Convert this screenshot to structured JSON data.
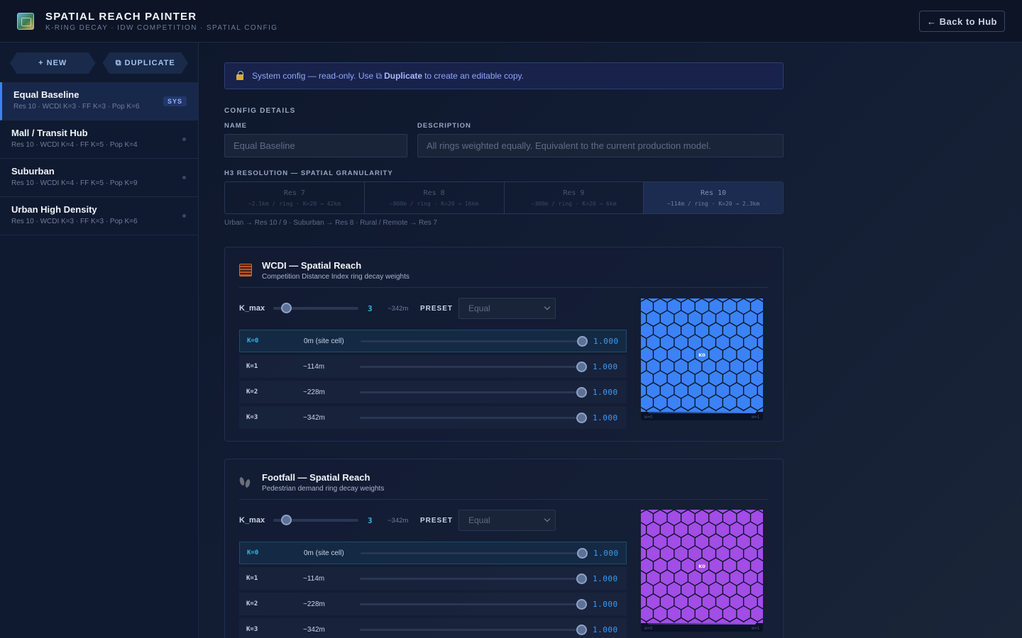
{
  "header": {
    "title": "SPATIAL REACH PAINTER",
    "subtitle": "K-RING DECAY · IDW COMPETITION · SPATIAL CONFIG",
    "back_label": "← Back to Hub",
    "logo_icon": "map-icon"
  },
  "sidebar": {
    "new_label": "+ NEW",
    "duplicate_label": "⧉ DUPLICATE",
    "items": [
      {
        "name": "Equal Baseline",
        "meta": "Res 10 · WCDI K=3 · FF K=3 · Pop K=6",
        "badge": "SYS",
        "active": true
      },
      {
        "name": "Mall / Transit Hub",
        "meta": "Res 10 · WCDI K=4 · FF K=5 · Pop K=4",
        "active": false
      },
      {
        "name": "Suburban",
        "meta": "Res 10 · WCDI K=4 · FF K=5 · Pop K=9",
        "active": false
      },
      {
        "name": "Urban High Density",
        "meta": "Res 10 · WCDI K=3 · FF K=3 · Pop K=6",
        "active": false
      }
    ]
  },
  "notice": {
    "lock_icon": "lock-icon",
    "prefix": "System config — read-only. Use ⧉",
    "bold": "Duplicate",
    "suffix": "to create an editable copy."
  },
  "config": {
    "section_title": "CONFIG DETAILS",
    "name_label": "NAME",
    "name_value": "Equal Baseline",
    "description_label": "DESCRIPTION",
    "description_value": "All rings weighted equally. Equivalent to the current production model.",
    "resolution_title": "H3 RESOLUTION — SPATIAL GRANULARITY",
    "resolutions": [
      {
        "name": "Res 7",
        "detail": "~2.1km / ring · K=20 → 42km"
      },
      {
        "name": "Res 8",
        "detail": "~800m / ring · K=20 → 16km"
      },
      {
        "name": "Res 9",
        "detail": "~300m / ring · K=20 → 6km"
      },
      {
        "name": "Res 10",
        "detail": "~114m / ring · K=20 → 2.3km",
        "selected": true
      }
    ],
    "resolution_hint": "Urban → Res 10 / 9 · Suburban → Res 8 · Rural / Remote → Res 7"
  },
  "panels": [
    {
      "title": "WCDI — Spatial Reach",
      "subtitle": "Competition Distance Index ring decay weights",
      "icon": "abacus-icon",
      "kmax_label": "K_max",
      "kmax_value": "3",
      "kmax_dist": "~342m",
      "preset_label": "PRESET",
      "preset_value": "Equal",
      "accent": "#3b82f6",
      "rings": [
        {
          "k": "K=0",
          "dist": "0m (site cell)",
          "weight": "1.000"
        },
        {
          "k": "K=1",
          "dist": "~114m",
          "weight": "1.000"
        },
        {
          "k": "K=2",
          "dist": "~228m",
          "weight": "1.000"
        },
        {
          "k": "K=3",
          "dist": "~342m",
          "weight": "1.000"
        }
      ],
      "center_label": "K0",
      "legend_lo": "w=0",
      "legend_hi": "w=1"
    },
    {
      "title": "Footfall — Spatial Reach",
      "subtitle": "Pedestrian demand ring decay weights",
      "icon": "footprints-icon",
      "kmax_label": "K_max",
      "kmax_value": "3",
      "kmax_dist": "~342m",
      "preset_label": "PRESET",
      "preset_value": "Equal",
      "accent": "#a24de6",
      "rings": [
        {
          "k": "K=0",
          "dist": "0m (site cell)",
          "weight": "1.000"
        },
        {
          "k": "K=1",
          "dist": "~114m",
          "weight": "1.000"
        },
        {
          "k": "K=2",
          "dist": "~228m",
          "weight": "1.000"
        },
        {
          "k": "K=3",
          "dist": "~342m",
          "weight": "1.000"
        }
      ],
      "center_label": "K0",
      "legend_lo": "w=0",
      "legend_hi": "w=1"
    }
  ]
}
